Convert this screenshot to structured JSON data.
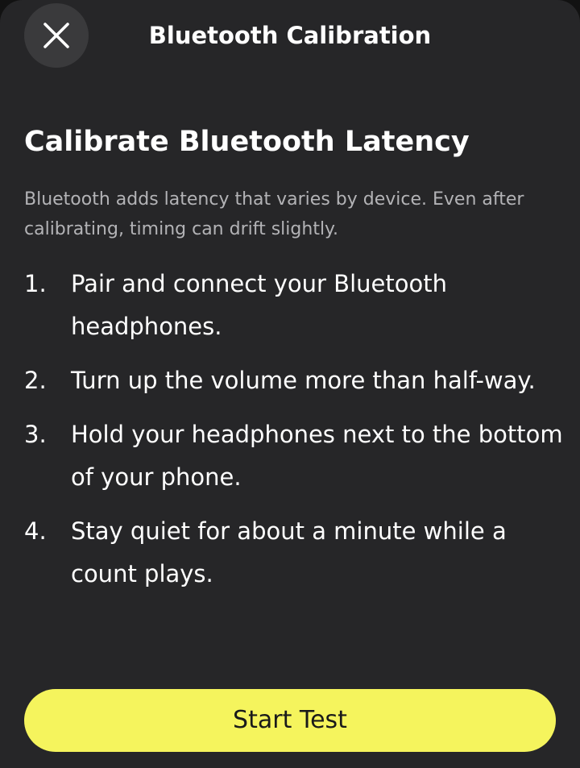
{
  "header": {
    "close_icon": "close-icon",
    "title": "Bluetooth Calibration"
  },
  "content": {
    "heading": "Calibrate Bluetooth Latency",
    "subtitle": "Bluetooth adds latency that varies by device. Even after calibrating, timing can drift slightly.",
    "steps": [
      {
        "number": "1.",
        "text": "Pair and connect your Bluetooth headphones."
      },
      {
        "number": "2.",
        "text": "Turn up the volume more than half-way."
      },
      {
        "number": "3.",
        "text": "Hold your headphones next to the bottom of your phone."
      },
      {
        "number": "4.",
        "text": "Stay quiet for about a minute while a count plays."
      }
    ]
  },
  "footer": {
    "start_label": "Start Test"
  },
  "colors": {
    "background": "#262628",
    "accent": "#f5f45d",
    "text": "#ffffff",
    "muted": "#b3b3b6"
  }
}
